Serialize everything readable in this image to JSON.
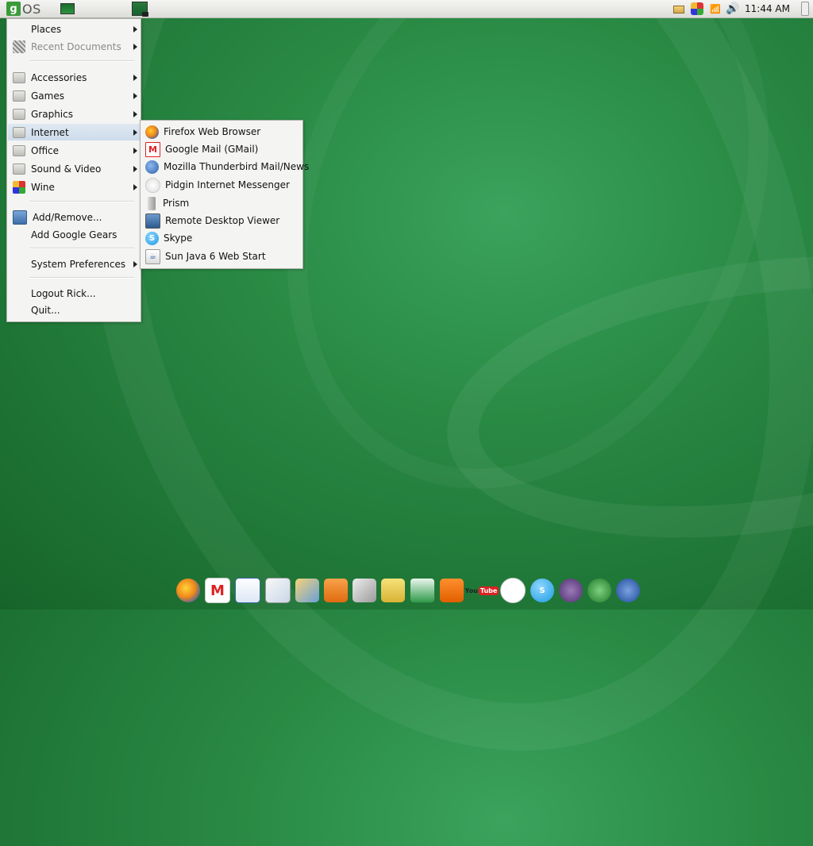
{
  "panel": {
    "logo_g": "g",
    "logo_os": "OS",
    "clock": "11:44 AM",
    "icons": [
      "show-desktop-icon",
      "screenshot-icon",
      "battery-icon",
      "wine-tray-icon",
      "network-icon",
      "volume-icon"
    ]
  },
  "main_menu": {
    "items": [
      {
        "label": "Places",
        "submenu": true
      },
      {
        "label": "Recent Documents",
        "submenu": true,
        "disabled": true
      },
      {
        "label": "Accessories",
        "submenu": true
      },
      {
        "label": "Games",
        "submenu": true
      },
      {
        "label": "Graphics",
        "submenu": true
      },
      {
        "label": "Internet",
        "submenu": true,
        "active": true
      },
      {
        "label": "Office",
        "submenu": true
      },
      {
        "label": "Sound & Video",
        "submenu": true
      },
      {
        "label": "Wine",
        "submenu": true
      },
      {
        "label": "Add/Remove...",
        "submenu": false
      },
      {
        "label": "Add Google Gears",
        "submenu": false
      },
      {
        "label": "System Preferences",
        "submenu": true
      },
      {
        "label": "Logout Rick...",
        "submenu": false
      },
      {
        "label": "Quit...",
        "submenu": false
      }
    ]
  },
  "internet_submenu": {
    "items": [
      {
        "label": "Firefox Web Browser",
        "icon": "firefox-icon"
      },
      {
        "label": "Google Mail (GMail)",
        "icon": "gmail-icon"
      },
      {
        "label": "Mozilla Thunderbird Mail/News",
        "icon": "thunderbird-icon"
      },
      {
        "label": "Pidgin Internet Messenger",
        "icon": "pidgin-icon"
      },
      {
        "label": "Prism",
        "icon": "prism-icon"
      },
      {
        "label": "Remote Desktop Viewer",
        "icon": "remote-desktop-icon"
      },
      {
        "label": "Skype",
        "icon": "skype-icon"
      },
      {
        "label": "Sun Java 6 Web Start",
        "icon": "java-icon"
      }
    ]
  },
  "dock": {
    "icons": [
      "firefox-icon",
      "gmail-icon",
      "calendar-icon",
      "docs-icon",
      "photos-icon",
      "rss-reader-icon",
      "news-icon",
      "shopping-icon",
      "spreadsheet-icon",
      "blogger-icon",
      "youtube-icon",
      "talk-icon",
      "skype-icon",
      "openoffice-icon",
      "openoffice-calc-icon",
      "openoffice-writer-icon"
    ],
    "youtube_text_1": "You",
    "youtube_text_2": "Tube",
    "gmail_glyph": "M"
  }
}
